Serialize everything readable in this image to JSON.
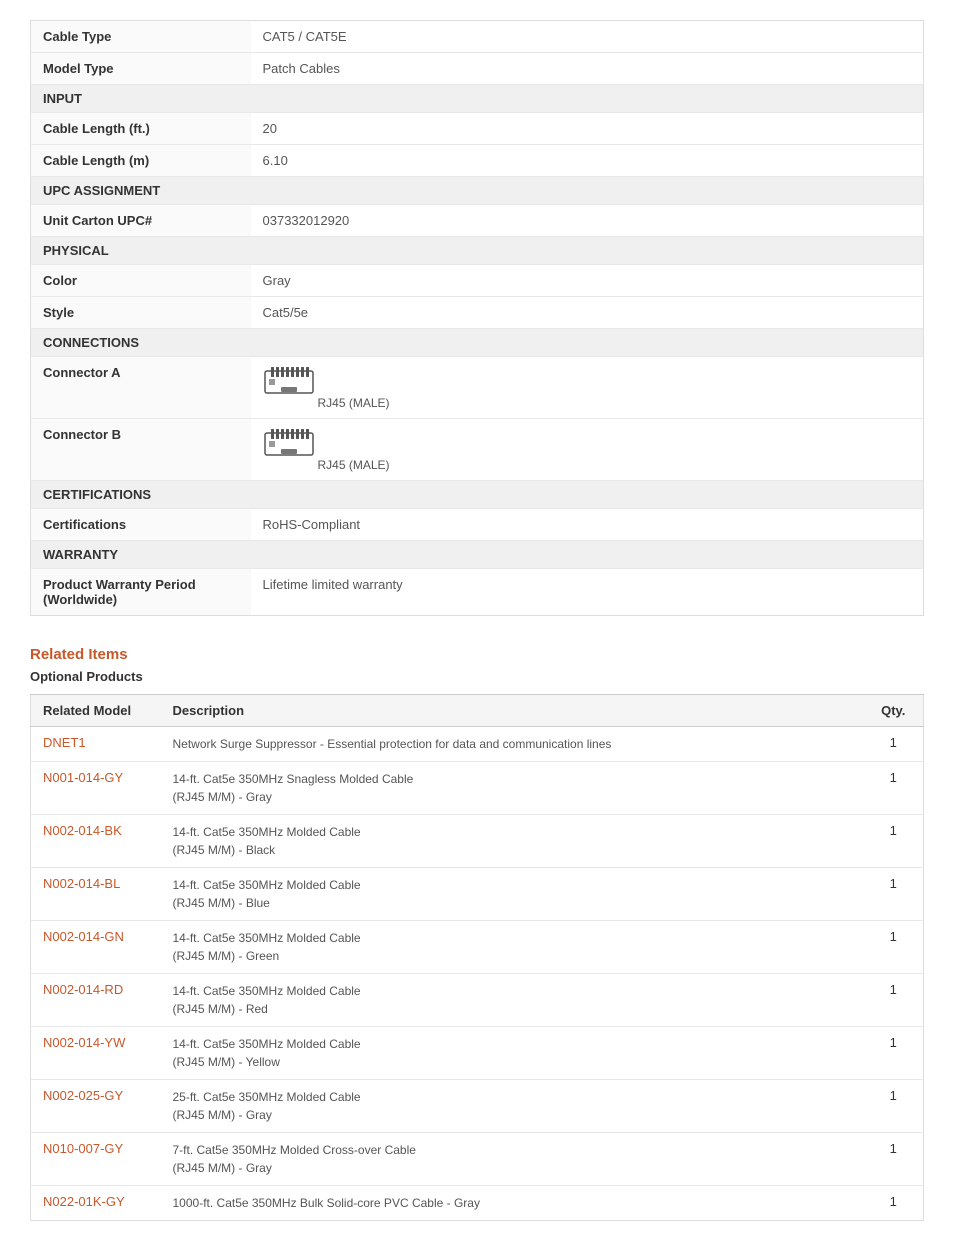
{
  "specs": {
    "rows": [
      {
        "type": "data",
        "label": "Cable Type",
        "value": "CAT5 / CAT5E"
      },
      {
        "type": "data",
        "label": "Model Type",
        "value": "Patch Cables"
      },
      {
        "type": "section",
        "label": "INPUT"
      },
      {
        "type": "data",
        "label": "Cable Length (ft.)",
        "value": "20"
      },
      {
        "type": "data",
        "label": "Cable Length (m)",
        "value": "6.10"
      },
      {
        "type": "section",
        "label": "UPC ASSIGNMENT"
      },
      {
        "type": "data",
        "label": "Unit Carton UPC#",
        "value": "037332012920"
      },
      {
        "type": "section",
        "label": "PHYSICAL"
      },
      {
        "type": "data",
        "label": "Color",
        "value": "Gray"
      },
      {
        "type": "data",
        "label": "Style",
        "value": "Cat5/5e"
      },
      {
        "type": "section",
        "label": "CONNECTIONS"
      },
      {
        "type": "connector",
        "label": "Connector A",
        "value": "RJ45 (MALE)"
      },
      {
        "type": "connector",
        "label": "Connector B",
        "value": "RJ45 (MALE)"
      },
      {
        "type": "section",
        "label": "CERTIFICATIONS"
      },
      {
        "type": "data",
        "label": "Certifications",
        "value": "RoHS-Compliant"
      },
      {
        "type": "section",
        "label": "WARRANTY"
      },
      {
        "type": "data",
        "label": "Product Warranty Period (Worldwide)",
        "value": "Lifetime limited warranty"
      }
    ]
  },
  "related_items": {
    "title": "Related Items",
    "optional_label": "Optional Products",
    "columns": {
      "model": "Related Model",
      "description": "Description",
      "qty": "Qty."
    },
    "rows": [
      {
        "model": "DNET1",
        "description": "Network Surge Suppressor - Essential protection for data and communication lines",
        "qty": "1"
      },
      {
        "model": "N001-014-GY",
        "description": "14-ft. Cat5e 350MHz Snagless Molded Cable\n(RJ45 M/M) - Gray",
        "qty": "1"
      },
      {
        "model": "N002-014-BK",
        "description": "14-ft. Cat5e 350MHz Molded Cable\n(RJ45 M/M) - Black",
        "qty": "1"
      },
      {
        "model": "N002-014-BL",
        "description": "14-ft. Cat5e 350MHz Molded Cable\n(RJ45 M/M) - Blue",
        "qty": "1"
      },
      {
        "model": "N002-014-GN",
        "description": "14-ft. Cat5e 350MHz Molded Cable\n(RJ45 M/M) - Green",
        "qty": "1"
      },
      {
        "model": "N002-014-RD",
        "description": "14-ft. Cat5e 350MHz Molded Cable\n(RJ45 M/M) - Red",
        "qty": "1"
      },
      {
        "model": "N002-014-YW",
        "description": "14-ft. Cat5e 350MHz Molded Cable\n(RJ45 M/M) - Yellow",
        "qty": "1"
      },
      {
        "model": "N002-025-GY",
        "description": "25-ft. Cat5e 350MHz Molded Cable\n(RJ45 M/M) - Gray",
        "qty": "1"
      },
      {
        "model": "N010-007-GY",
        "description": "7-ft. Cat5e 350MHz Molded Cross-over Cable\n(RJ45 M/M) - Gray",
        "qty": "1"
      },
      {
        "model": "N022-01K-GY",
        "description": "1000-ft. Cat5e 350MHz Bulk Solid-core PVC Cable - Gray",
        "qty": "1"
      }
    ]
  }
}
